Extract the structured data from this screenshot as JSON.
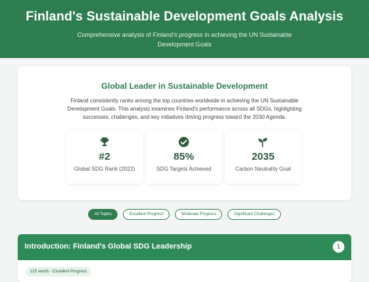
{
  "header": {
    "title": "Finland's Sustainable Development Goals Analysis",
    "subtitle": "Comprehensive analysis of Finland's progress in achieving the UN Sustainable Development Goals"
  },
  "overview": {
    "title": "Global Leader in Sustainable Development",
    "description": "Finland consistently ranks among the top countries worldwide in achieving the UN Sustainable Development Goals. This analysis examines Finland's performance across all SDGs, highlighting successes, challenges, and key initiatives driving progress toward the 2030 Agenda.",
    "stats": [
      {
        "icon": "trophy-icon",
        "value": "#2",
        "label": "Global SDG Rank (2022)"
      },
      {
        "icon": "check-circle-icon",
        "value": "85%",
        "label": "SDG Targets Achieved"
      },
      {
        "icon": "sprout-icon",
        "value": "2035",
        "label": "Carbon Neutrality Goal"
      }
    ]
  },
  "filters": [
    "All Topics",
    "Excellent Progress",
    "Moderate Progress",
    "Significant Challenges"
  ],
  "active_filter": "All Topics",
  "sections": [
    {
      "title": "Introduction: Finland's Global SDG Leadership",
      "number": "1",
      "badge": "125 words - Excellent Progress"
    }
  ],
  "colors": {
    "primary": "#2e7d4f",
    "header_bar": "#2e8b57",
    "badge_bg": "#e5f3e9",
    "background": "#f3f5f4"
  }
}
